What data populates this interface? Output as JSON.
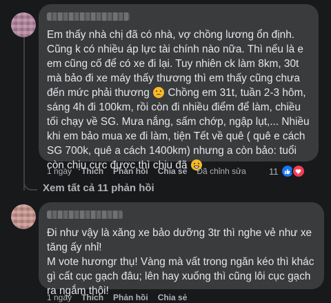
{
  "comments": [
    {
      "text_a": "Em thấy nhà chị đã có nhà, vợ chồng lương ổn định.\nCũng k có nhiều áp lực tài chính nào nữa. Thì nếu là e em cũng cố để có xe đi lại. Tuy nhiên ck làm 8km, 30t mà bảo đi xe máy thấy thương thì em thấy cũng chưa đến mức phải thương",
      "emoji_1": "sad-face-emoji",
      "text_b": " Chồng em 31t, tuần 2-3 hôm, sáng 4h đi 100km, rồi còn đi nhiều điểm để làm, chiều tối chạy về SG. Mưa nắng, sấm chớp, ngập lụt,... Nhiều khi em bảo mua xe đi làm, tiện Tết về quê ( quê e cách SG 700k, quê a cách 1400km) nhưng a còn bảo: tuổi còn chịu cực được thì chịu đã ",
      "emoji_2": "sweat-smile-emoji",
      "time": "1 ngày",
      "like": "Thích",
      "reply": "Phản hồi",
      "share": "Chia sẻ",
      "edited": "Đã chỉnh sửa",
      "reaction_count": "11"
    },
    {
      "text": "Đi như vậy là xăng xe bảo dưỡng 3tr thì nghe vẻ như xe tăng ấy nhỉ!\nM vote hươngr thụ! Vàng mà vất trong ngăn kéo thì khác gì cất cục gạch đâu; lên hay xuống thì cũng lôi cục gạch ra ngắm thôi!",
      "time": "1 ngày",
      "like": "Thích",
      "reply": "Phản hồi",
      "share": "Chia sẻ"
    }
  ],
  "view_replies": "Xem tất cả 11 phản hồi",
  "colors": {
    "background": "#18191a",
    "bubble": "#3a3b3c",
    "text": "#e4e6eb",
    "secondary": "#b0b3b8",
    "like": "#1877f2",
    "love": "#f33e58"
  },
  "icons": {
    "like": "thumbs-up-icon",
    "love": "heart-icon"
  }
}
